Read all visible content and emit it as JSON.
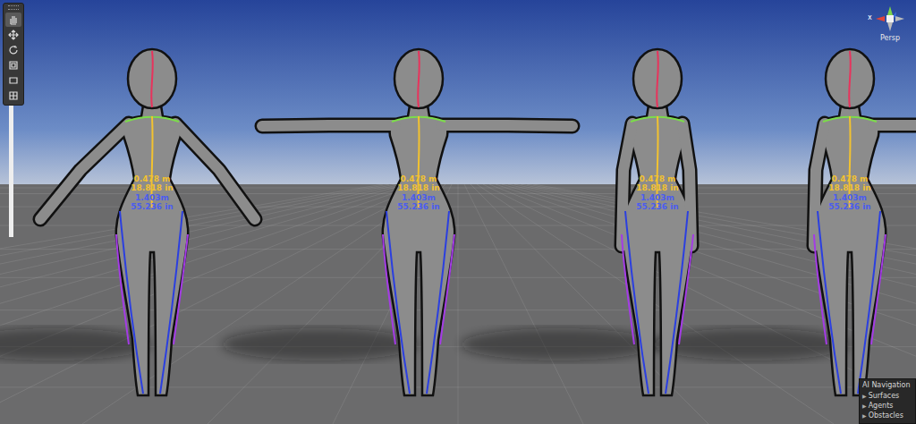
{
  "toolbar": {
    "tools": [
      {
        "kind": "hand",
        "selected": true
      },
      {
        "kind": "move",
        "selected": false
      },
      {
        "kind": "rotate",
        "selected": false
      },
      {
        "kind": "scale",
        "selected": false
      },
      {
        "kind": "rect",
        "selected": false
      },
      {
        "kind": "transform",
        "selected": false
      }
    ]
  },
  "gizmo": {
    "axis_label": "x",
    "projection": "Persp"
  },
  "guides": [
    {
      "part": "head",
      "color": "#e8335c"
    },
    {
      "part": "shoulders",
      "color": "#7cdc4a"
    },
    {
      "part": "spine",
      "color": "#f2c230"
    },
    {
      "part": "legs",
      "color": "#2b3fe0"
    },
    {
      "part": "hips",
      "color": "#a43be6"
    }
  ],
  "figures": [
    {
      "kind": "a-pose",
      "labels": [
        {
          "text": "0.478 m",
          "color": "#f2c230"
        },
        {
          "text": "18.818 in",
          "color": "#f2c230"
        },
        {
          "text": "1.403m",
          "color": "#4a5cf0"
        },
        {
          "text": "55.236 in",
          "color": "#4a5cf0"
        }
      ]
    },
    {
      "kind": "t-pose",
      "labels": [
        {
          "text": "0.478 m",
          "color": "#f2c230"
        },
        {
          "text": "18.818 in",
          "color": "#f2c230"
        },
        {
          "text": "1.403m",
          "color": "#4a5cf0"
        },
        {
          "text": "55.236 in",
          "color": "#4a5cf0"
        }
      ]
    },
    {
      "kind": "arms-down",
      "labels": [
        {
          "text": "0.478 m",
          "color": "#f2c230"
        },
        {
          "text": "18.818 in",
          "color": "#f2c230"
        },
        {
          "text": "1.403m",
          "color": "#4a5cf0"
        },
        {
          "text": "55.236 in",
          "color": "#4a5cf0"
        }
      ]
    },
    {
      "kind": "one-arm-out",
      "labels": [
        {
          "text": "0.478 m",
          "color": "#f2c230"
        },
        {
          "text": "18.818 in",
          "color": "#f2c230"
        },
        {
          "text": "1.403m",
          "color": "#4a5cf0"
        },
        {
          "text": "55.236 in",
          "color": "#4a5cf0"
        }
      ]
    }
  ],
  "overlay": {
    "title": "AI Navigation",
    "items": [
      {
        "arrow": "▶",
        "label": "Surfaces",
        "expanded": false
      },
      {
        "arrow": "▶",
        "label": "Agents",
        "expanded": false
      },
      {
        "arrow": "▶",
        "label": "Obstacles",
        "expanded": false
      }
    ]
  }
}
